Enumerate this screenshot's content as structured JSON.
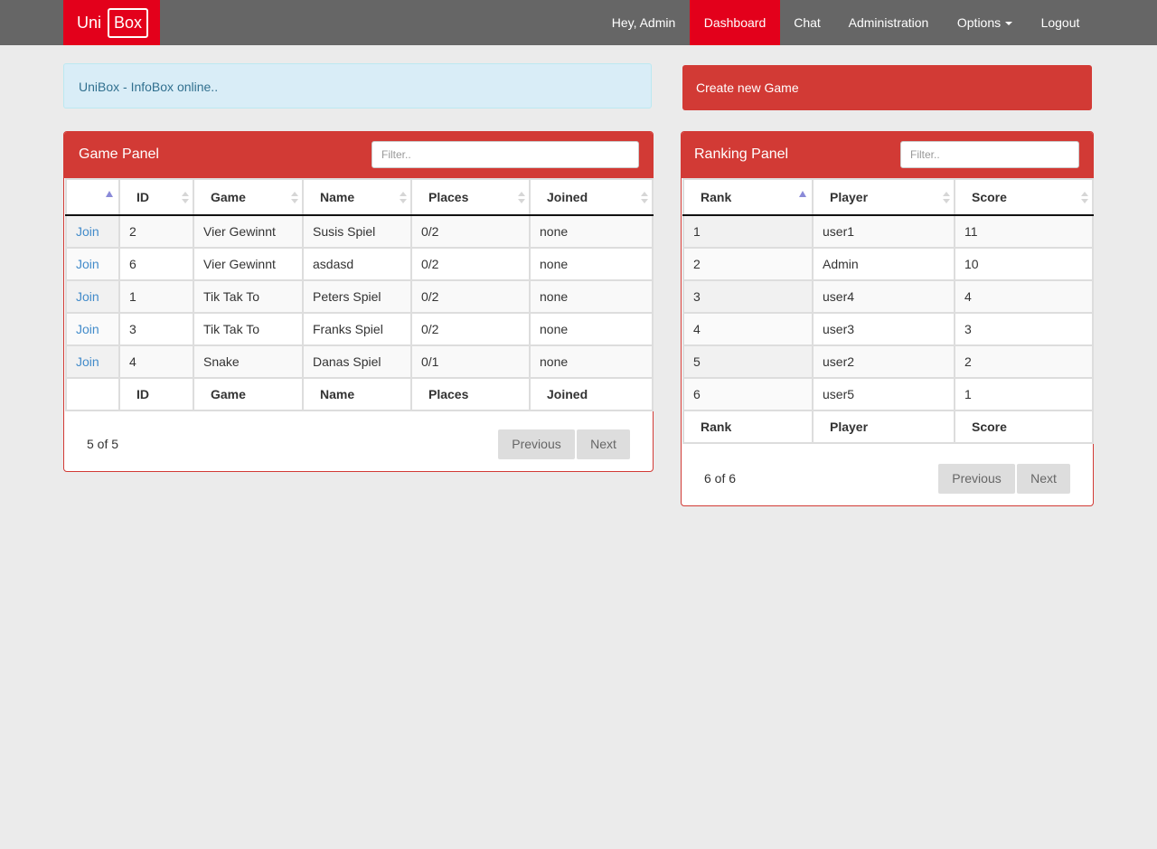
{
  "navbar": {
    "brand_uni": "Uni",
    "brand_box": "Box",
    "greeting": "Hey, Admin",
    "dashboard": "Dashboard",
    "chat": "Chat",
    "administration": "Administration",
    "options": "Options",
    "logout": "Logout"
  },
  "infobox": {
    "text": "UniBox - InfoBox online.."
  },
  "create_game": {
    "label": "Create new Game"
  },
  "game_panel": {
    "title": "Game Panel",
    "filter_placeholder": "Filter..",
    "columns": [
      "",
      "ID",
      "Game",
      "Name",
      "Places",
      "Joined"
    ],
    "rows": [
      {
        "action": "Join",
        "id": "2",
        "game": "Vier Gewinnt",
        "name": "Susis Spiel",
        "places": "0/2",
        "joined": "none"
      },
      {
        "action": "Join",
        "id": "6",
        "game": "Vier Gewinnt",
        "name": "asdasd",
        "places": "0/2",
        "joined": "none"
      },
      {
        "action": "Join",
        "id": "1",
        "game": "Tik Tak To",
        "name": "Peters Spiel",
        "places": "0/2",
        "joined": "none"
      },
      {
        "action": "Join",
        "id": "3",
        "game": "Tik Tak To",
        "name": "Franks Spiel",
        "places": "0/2",
        "joined": "none"
      },
      {
        "action": "Join",
        "id": "4",
        "game": "Snake",
        "name": "Danas Spiel",
        "places": "0/1",
        "joined": "none"
      }
    ],
    "info": "5 of 5",
    "previous": "Previous",
    "next": "Next"
  },
  "ranking_panel": {
    "title": "Ranking Panel",
    "filter_placeholder": "Filter..",
    "columns": [
      "Rank",
      "Player",
      "Score"
    ],
    "rows": [
      {
        "rank": "1",
        "player": "user1",
        "score": "11"
      },
      {
        "rank": "2",
        "player": "Admin",
        "score": "10"
      },
      {
        "rank": "3",
        "player": "user4",
        "score": "4"
      },
      {
        "rank": "4",
        "player": "user3",
        "score": "3"
      },
      {
        "rank": "5",
        "player": "user2",
        "score": "2"
      },
      {
        "rank": "6",
        "player": "user5",
        "score": "1"
      }
    ],
    "info": "6 of 6",
    "previous": "Previous",
    "next": "Next"
  },
  "colors": {
    "brand_red": "#e3001b",
    "panel_red": "#d23a35",
    "navbar_gray": "#666666",
    "info_bg": "#d9edf7",
    "link_blue": "#428bca"
  }
}
